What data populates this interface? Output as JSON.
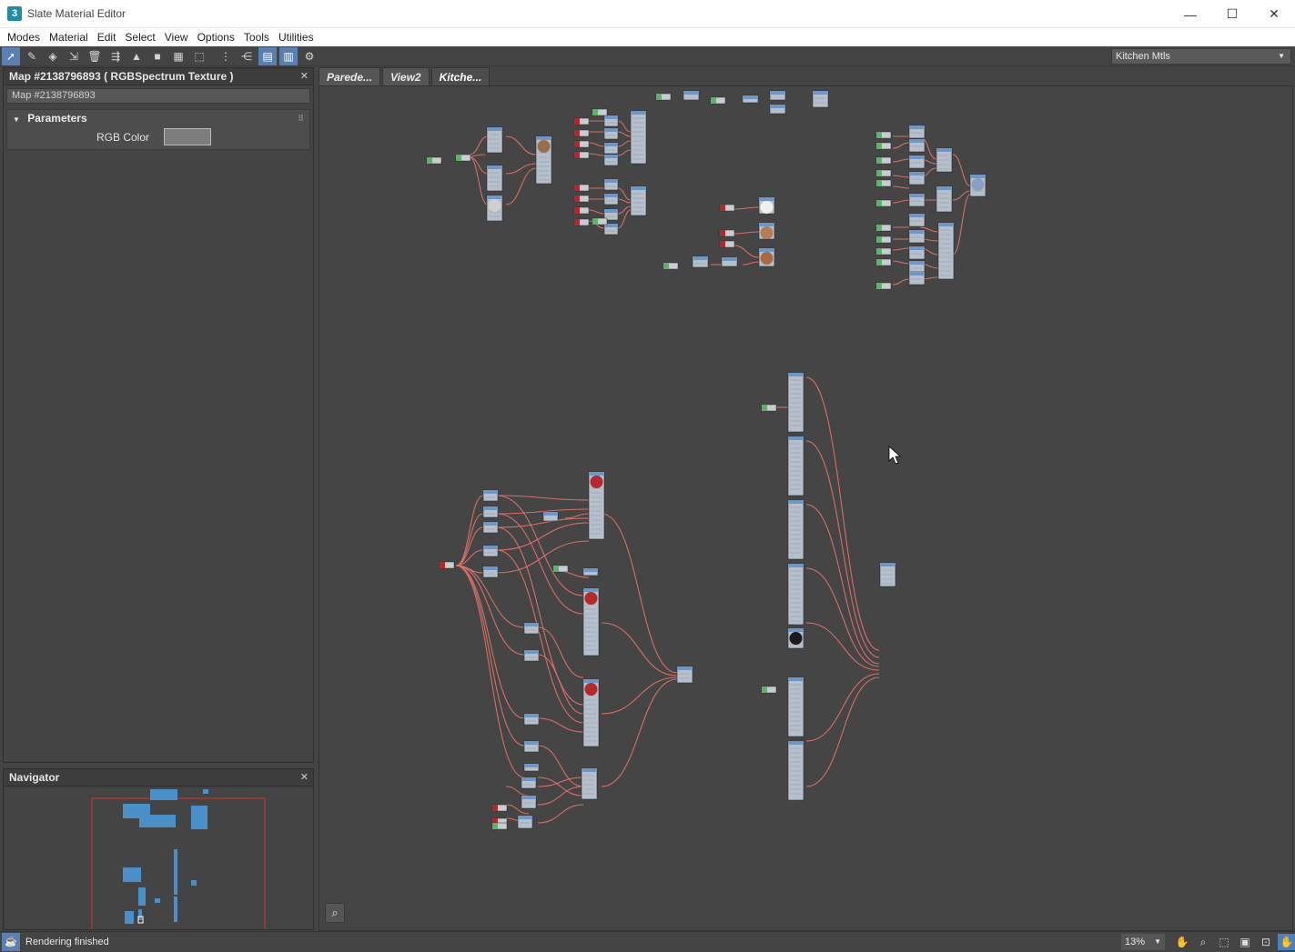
{
  "window": {
    "app_icon": "3",
    "title": "Slate Material Editor",
    "minimize": "—",
    "maximize": "☐",
    "close": "✕"
  },
  "menu": [
    "Modes",
    "Material",
    "Edit",
    "Select",
    "View",
    "Options",
    "Tools",
    "Utilities"
  ],
  "toolbar": {
    "view_selector": "Kitchen Mtls"
  },
  "param_panel": {
    "header": "Map #2138796893  ( RGBSpectrum Texture )",
    "close": "✕",
    "name_field": "Map #2138796893",
    "rollout_title": "Parameters",
    "rgb_label": "RGB Color",
    "rgb_color": "#7d7d7d"
  },
  "navigator": {
    "header": "Navigator",
    "close": "✕"
  },
  "tabs": [
    {
      "label": "Parede...",
      "active": false
    },
    {
      "label": "View2",
      "active": false
    },
    {
      "label": "Kitche...",
      "active": true
    }
  ],
  "status": {
    "text": "Rendering finished",
    "zoom": "13%"
  },
  "colors": {
    "wire": "#e5736a",
    "node_body": "#b6c0cc",
    "node_header": "#6f96c4",
    "green_map": "#5fb06a",
    "red_map": "#b4282d",
    "nav_frame": "#d0342c",
    "nav_node": "#4a8fc7"
  }
}
